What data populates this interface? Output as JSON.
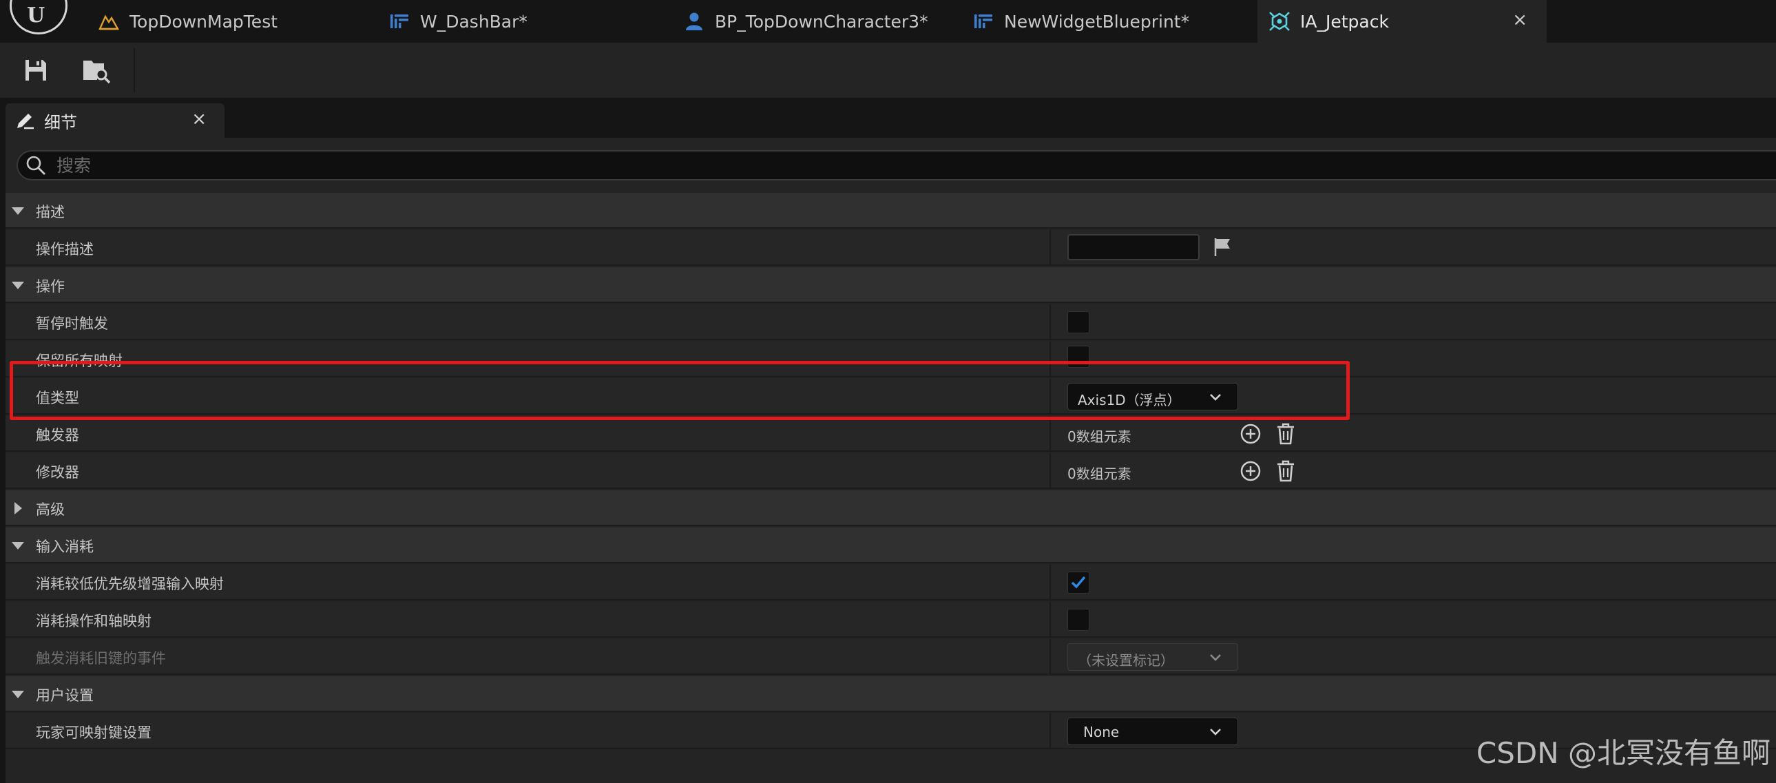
{
  "tabs": [
    {
      "label": "TopDownMapTest",
      "icon": "level-map-icon",
      "active": false
    },
    {
      "label": "W_DashBar*",
      "icon": "widget-blueprint-icon",
      "active": false
    },
    {
      "label": "BP_TopDownCharacter3*",
      "icon": "character-blueprint-icon",
      "active": false
    },
    {
      "label": "NewWidgetBlueprint*",
      "icon": "widget-blueprint-icon",
      "active": false
    },
    {
      "label": "IA_Jetpack",
      "icon": "input-action-icon",
      "active": true,
      "close": "×"
    }
  ],
  "toolbar": {
    "save_icon": "save-icon",
    "browse_icon": "browse-to-asset-icon"
  },
  "details_panel": {
    "title": "细节",
    "close": "×",
    "search_placeholder": "搜索"
  },
  "sections": [
    {
      "label": "描述",
      "expanded": true,
      "props": [
        {
          "name": "操作描述",
          "control": "text",
          "value": ""
        }
      ]
    },
    {
      "label": "操作",
      "expanded": true,
      "props": [
        {
          "name": "暂停时触发",
          "control": "checkbox",
          "checked": false
        },
        {
          "name": "保留所有映射",
          "control": "checkbox",
          "checked": false
        },
        {
          "name": "值类型",
          "control": "combo",
          "value": "Axis1D（浮点）",
          "highlighted": true
        },
        {
          "name": "触发器",
          "control": "array",
          "value": "0数组元素"
        },
        {
          "name": "修改器",
          "control": "array",
          "value": "0数组元素"
        }
      ]
    },
    {
      "label": "高级",
      "expanded": false,
      "props": []
    },
    {
      "label": "输入消耗",
      "expanded": true,
      "props": [
        {
          "name": "消耗较低优先级增强输入映射",
          "control": "checkbox",
          "checked": true
        },
        {
          "name": "消耗操作和轴映射",
          "control": "checkbox",
          "checked": false
        },
        {
          "name": "触发消耗旧键的事件",
          "control": "combo",
          "value": "（未设置标记）",
          "disabled": true
        }
      ]
    },
    {
      "label": "用户设置",
      "expanded": true,
      "props": [
        {
          "name": "玩家可映射键设置",
          "control": "combo",
          "value": "None"
        }
      ]
    }
  ],
  "colors": {
    "background": "#151515",
    "panel": "#242424",
    "category_row": "#303030",
    "highlight_box": "#e01b1b",
    "checkbox_check": "#2f8ae6",
    "level_icon": "#e0a030",
    "blueprint_icon": "#3f7fd0",
    "input_action_icon": "#5ad0e0"
  },
  "watermark": "CSDN @北冥没有鱼啊"
}
